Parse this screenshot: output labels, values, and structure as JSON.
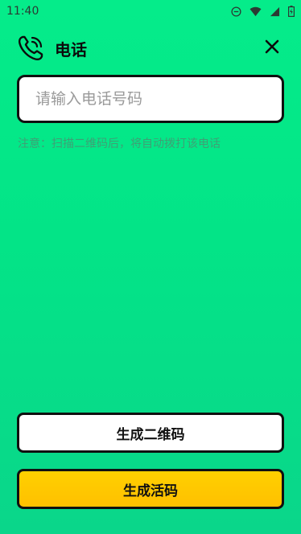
{
  "status_bar": {
    "time": "11:40",
    "icons": [
      "do-not-disturb-icon",
      "wifi-icon",
      "signal-icon",
      "battery-icon"
    ]
  },
  "header": {
    "icon": "phone-icon",
    "title": "电话",
    "close_icon": "close-icon"
  },
  "form": {
    "phone_placeholder": "请输入电话号码",
    "phone_value": "",
    "note": "注意：扫描二维码后，将自动拨打该电话"
  },
  "actions": {
    "generate_qr_label": "生成二维码",
    "generate_live_label": "生成活码"
  },
  "colors": {
    "background": "#05ec8a",
    "primary_button": "#ffc800",
    "note_text": "#3f9f75"
  }
}
